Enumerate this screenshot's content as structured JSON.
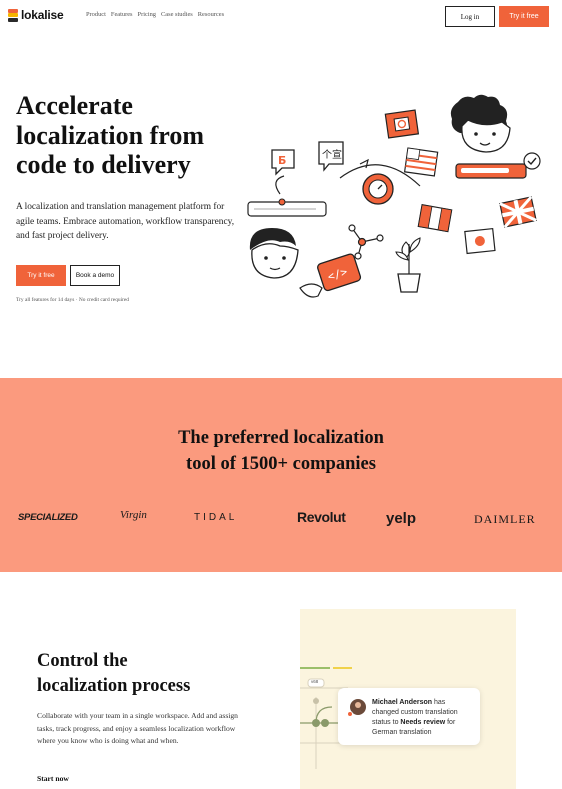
{
  "header": {
    "logo_text": "lokalise",
    "nav": [
      "Product",
      "Features",
      "Pricing",
      "Case studies",
      "Resources"
    ],
    "login_label": "Log in",
    "try_label": "Try it free"
  },
  "hero": {
    "title_lines": [
      "Accelerate",
      "localization from",
      "code to delivery"
    ],
    "description": "A localization and translation management platform for agile teams. Embrace automation, workflow transparency, and fast project delivery.",
    "try_label": "Try it free",
    "demo_label": "Book a demo",
    "note": "Try all features for 14 days · No credit card required"
  },
  "customers": {
    "title_lines": [
      "The preferred localization",
      "tool of 1500+ companies"
    ],
    "logos": [
      "SPECIALIZED",
      "Virgin",
      "TIDAL",
      "Revolut",
      "yelp",
      "DAIMLER"
    ]
  },
  "feature": {
    "title_lines": [
      "Control the",
      "localization process"
    ],
    "description": "Collaborate with your team in a single workspace. Add and assign tasks, track progress, and enjoy a seamless localization workflow where you know who is doing what and when.",
    "link_label": "Start now",
    "notification": {
      "name": "Michael Anderson",
      "text_before": " has changed custom translation status to ",
      "status": "Needs review",
      "text_after": " for German translation"
    },
    "badge": "v68"
  },
  "colors": {
    "accent": "#f0633a",
    "band": "#fb9a7e",
    "panel": "#fbf4de"
  }
}
